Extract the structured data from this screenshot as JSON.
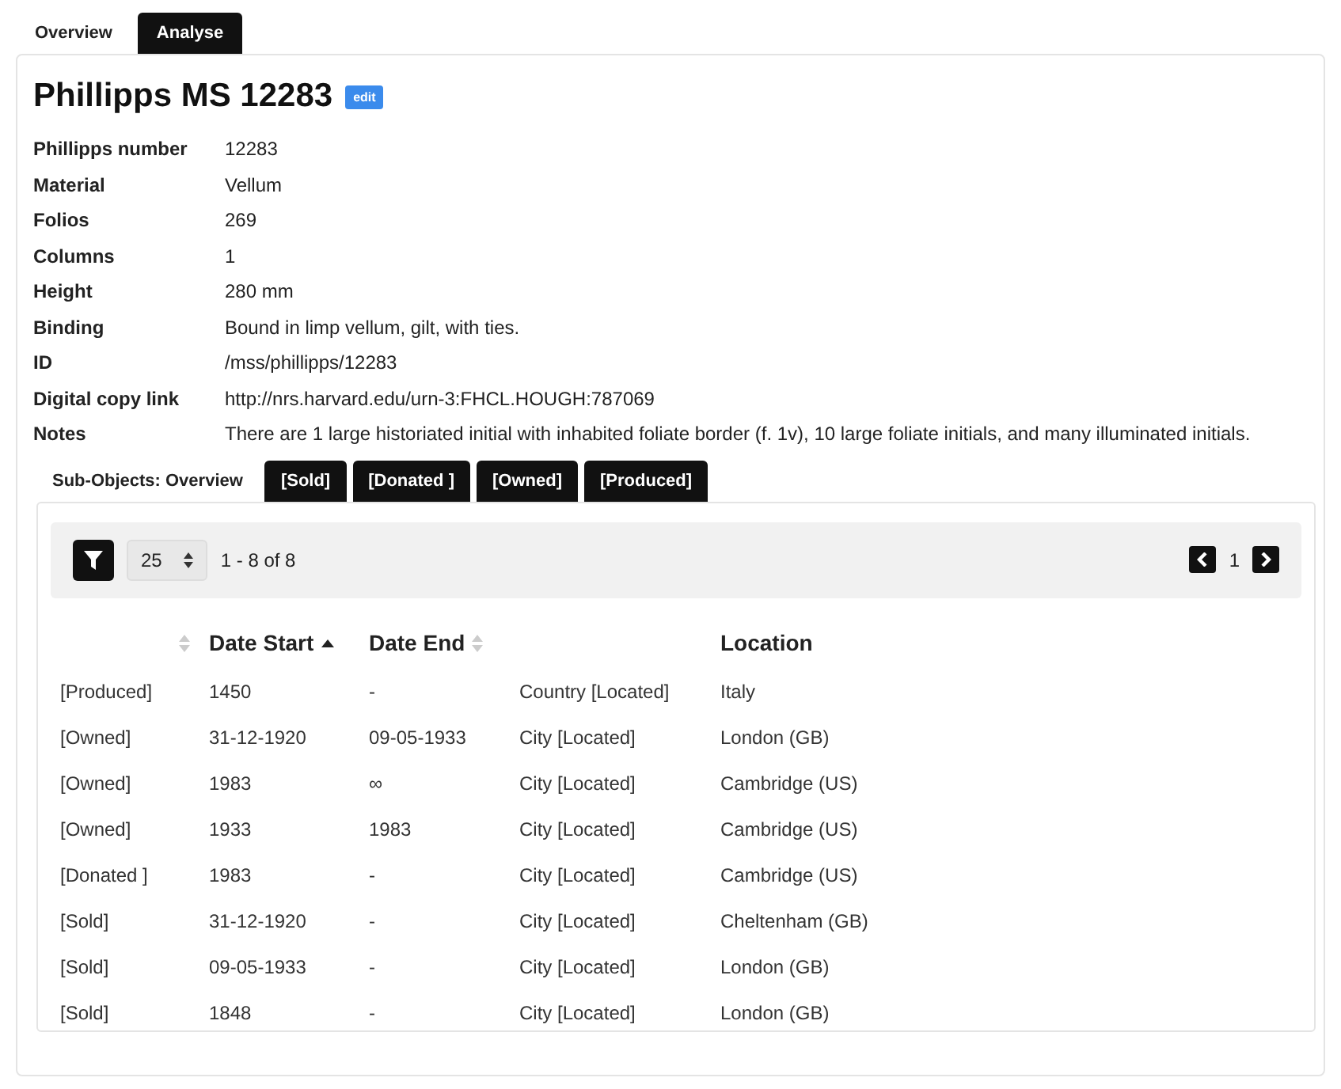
{
  "tabs": [
    {
      "label": "Overview",
      "selected": true
    },
    {
      "label": "Analyse",
      "selected": false
    }
  ],
  "title": "Phillipps MS 12283",
  "edit_button": "edit",
  "properties": [
    {
      "label": "Phillipps number",
      "value": "12283"
    },
    {
      "label": "Material",
      "value": "Vellum"
    },
    {
      "label": "Folios",
      "value": "269"
    },
    {
      "label": "Columns",
      "value": "1"
    },
    {
      "label": "Height",
      "value": "280 mm"
    },
    {
      "label": "Binding",
      "value": "Bound in limp vellum, gilt, with ties."
    },
    {
      "label": "ID",
      "value": "/mss/phillipps/12283"
    },
    {
      "label": "Digital copy link",
      "value": "http://nrs.harvard.edu/urn-3:FHCL.HOUGH:787069"
    },
    {
      "label": "Notes",
      "value": "There are 1 large historiated initial with inhabited foliate border (f. 1v), 10 large foliate initials, and many illuminated initials."
    }
  ],
  "sub_tabs": [
    {
      "label": "Sub-Objects: Overview",
      "selected": true
    },
    {
      "label": "[Sold]",
      "selected": false
    },
    {
      "label": "[Donated ]",
      "selected": false
    },
    {
      "label": "[Owned]",
      "selected": false
    },
    {
      "label": "[Produced]",
      "selected": false
    }
  ],
  "toolbar": {
    "page_size": "25",
    "range": "1 - 8 of 8",
    "page": "1"
  },
  "table": {
    "columns": [
      {
        "sortable": true,
        "sorted": false
      },
      {
        "label": "Date Start",
        "sortable": true,
        "sorted": true
      },
      {
        "label": "Date End",
        "sortable": true,
        "sorted": false
      },
      {},
      {
        "label": "Location"
      }
    ],
    "rows": [
      [
        "[Produced]",
        "1450",
        "-",
        "Country [Located]",
        "Italy"
      ],
      [
        "[Owned]",
        "31-12-1920",
        "09-05-1933",
        "City [Located]",
        "London (GB)"
      ],
      [
        "[Owned]",
        "1983",
        "∞",
        "City [Located]",
        "Cambridge (US)"
      ],
      [
        "[Owned]",
        "1933",
        "1983",
        "City [Located]",
        "Cambridge (US)"
      ],
      [
        "[Donated ]",
        "1983",
        "-",
        "City [Located]",
        "Cambridge (US)"
      ],
      [
        "[Sold]",
        "31-12-1920",
        "-",
        "City [Located]",
        "Cheltenham (GB)"
      ],
      [
        "[Sold]",
        "09-05-1933",
        "-",
        "City [Located]",
        "London (GB)"
      ],
      [
        "[Sold]",
        "1848",
        "-",
        "City [Located]",
        "London (GB)"
      ]
    ]
  }
}
